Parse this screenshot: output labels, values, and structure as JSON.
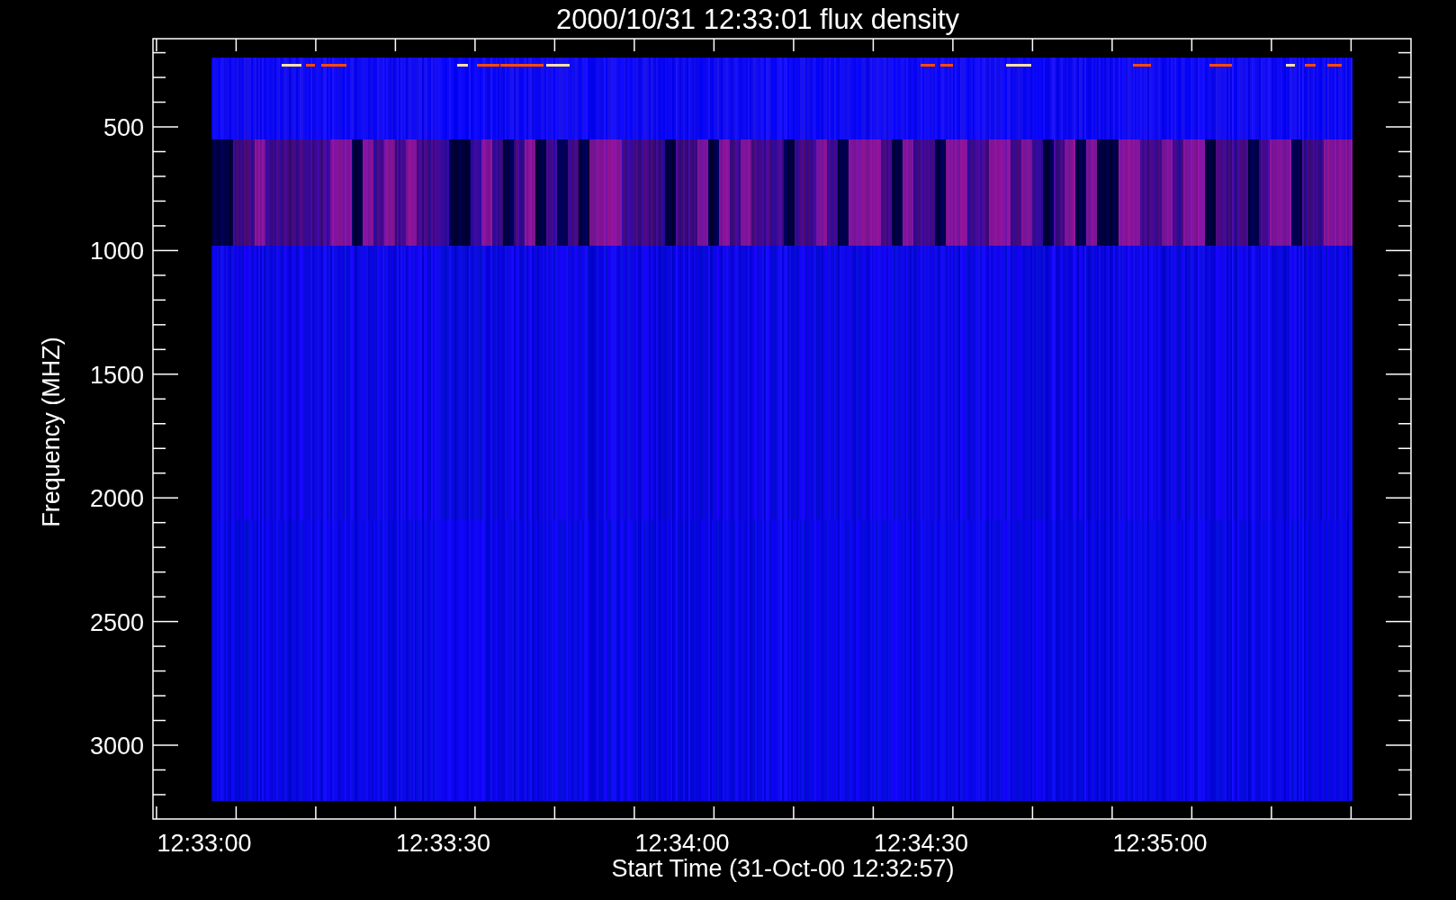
{
  "plot": {
    "title": "2000/10/31 12:33:01 flux density",
    "ylabel": "Frequency (MHZ)",
    "xlabel": "Start Time (31-Oct-00 12:32:57)",
    "yticks": [
      "500",
      "1000",
      "1500",
      "2000",
      "2500",
      "3000"
    ],
    "xticks": [
      "12:33:00",
      "12:33:30",
      "12:34:00",
      "12:34:30",
      "12:35:00"
    ]
  }
}
